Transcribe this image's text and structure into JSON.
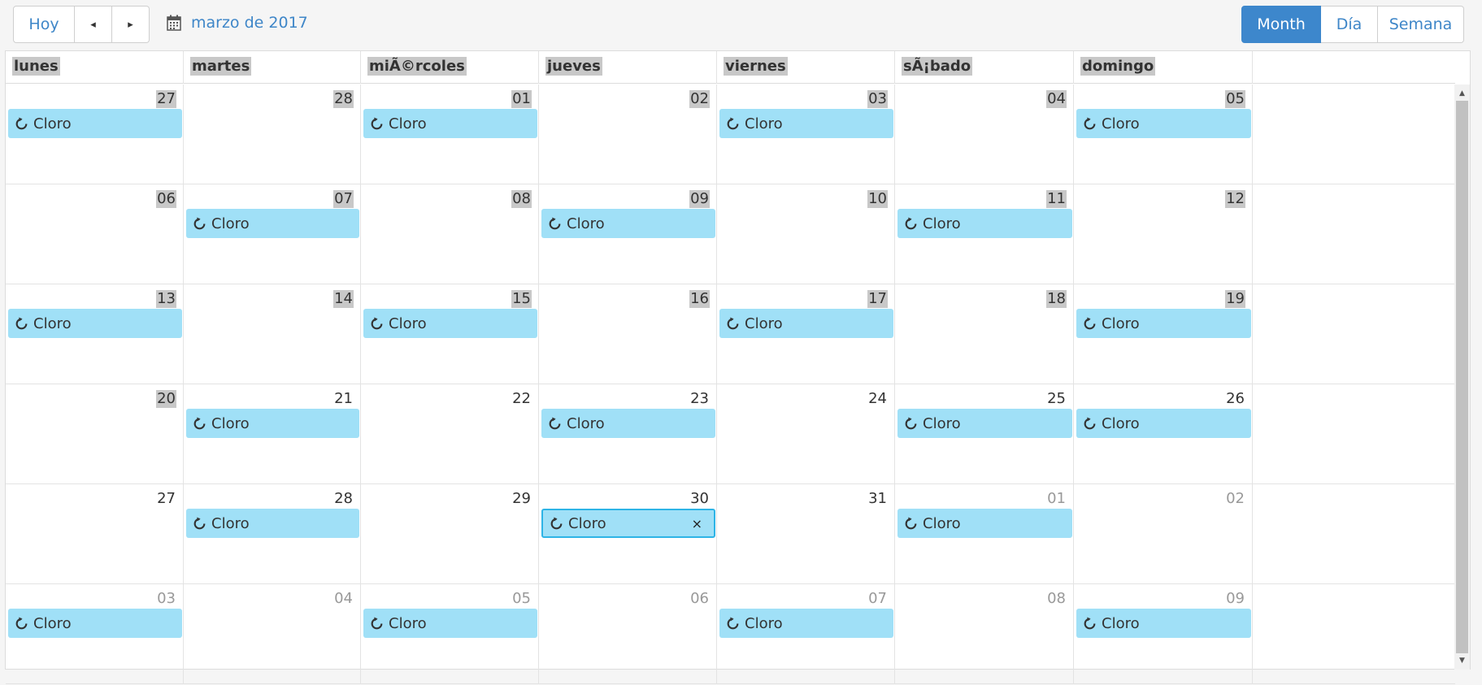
{
  "toolbar": {
    "today_label": "Hoy",
    "prev_label": "◂",
    "next_label": "▸",
    "date_label": "marzo de 2017",
    "calendar_icon": "calendar-icon",
    "views": [
      {
        "label": "Month",
        "active": true
      },
      {
        "label": "Día",
        "active": false
      },
      {
        "label": "Semana",
        "active": false
      }
    ]
  },
  "headers": [
    "lunes",
    "martes",
    "miÃ©rcoles",
    "jueves",
    "viernes",
    "sÃ¡bado",
    "domingo"
  ],
  "event_icon": "refresh-icon",
  "close_label": "×",
  "weeks": [
    [
      {
        "num": "27",
        "highlight": true,
        "other": false,
        "event": "Cloro"
      },
      {
        "num": "28",
        "highlight": true,
        "other": false,
        "event": ""
      },
      {
        "num": "01",
        "highlight": true,
        "other": false,
        "event": "Cloro"
      },
      {
        "num": "02",
        "highlight": true,
        "other": false,
        "event": ""
      },
      {
        "num": "03",
        "highlight": true,
        "other": false,
        "event": "Cloro"
      },
      {
        "num": "04",
        "highlight": true,
        "other": false,
        "event": ""
      },
      {
        "num": "05",
        "highlight": true,
        "other": false,
        "event": "Cloro"
      }
    ],
    [
      {
        "num": "06",
        "highlight": true,
        "other": false,
        "event": ""
      },
      {
        "num": "07",
        "highlight": true,
        "other": false,
        "event": "Cloro"
      },
      {
        "num": "08",
        "highlight": true,
        "other": false,
        "event": ""
      },
      {
        "num": "09",
        "highlight": true,
        "other": false,
        "event": "Cloro"
      },
      {
        "num": "10",
        "highlight": true,
        "other": false,
        "event": ""
      },
      {
        "num": "11",
        "highlight": true,
        "other": false,
        "event": "Cloro"
      },
      {
        "num": "12",
        "highlight": true,
        "other": false,
        "event": ""
      }
    ],
    [
      {
        "num": "13",
        "highlight": true,
        "other": false,
        "event": "Cloro"
      },
      {
        "num": "14",
        "highlight": true,
        "other": false,
        "event": ""
      },
      {
        "num": "15",
        "highlight": true,
        "other": false,
        "event": "Cloro"
      },
      {
        "num": "16",
        "highlight": true,
        "other": false,
        "event": ""
      },
      {
        "num": "17",
        "highlight": true,
        "other": false,
        "event": "Cloro"
      },
      {
        "num": "18",
        "highlight": true,
        "other": false,
        "event": ""
      },
      {
        "num": "19",
        "highlight": true,
        "other": false,
        "event": "Cloro"
      }
    ],
    [
      {
        "num": "20",
        "highlight": true,
        "other": false,
        "event": ""
      },
      {
        "num": "21",
        "highlight": false,
        "other": false,
        "event": "Cloro"
      },
      {
        "num": "22",
        "highlight": false,
        "other": false,
        "event": ""
      },
      {
        "num": "23",
        "highlight": false,
        "other": false,
        "event": "Cloro"
      },
      {
        "num": "24",
        "highlight": false,
        "other": false,
        "event": ""
      },
      {
        "num": "25",
        "highlight": false,
        "other": false,
        "event": "Cloro"
      },
      {
        "num": "26",
        "highlight": false,
        "other": false,
        "event": "Cloro"
      }
    ],
    [
      {
        "num": "27",
        "highlight": false,
        "other": false,
        "event": ""
      },
      {
        "num": "28",
        "highlight": false,
        "other": false,
        "event": "Cloro"
      },
      {
        "num": "29",
        "highlight": false,
        "other": false,
        "event": ""
      },
      {
        "num": "30",
        "highlight": false,
        "other": false,
        "event": "Cloro",
        "selected": true
      },
      {
        "num": "31",
        "highlight": false,
        "other": false,
        "event": ""
      },
      {
        "num": "01",
        "highlight": false,
        "other": true,
        "event": "Cloro"
      },
      {
        "num": "02",
        "highlight": false,
        "other": true,
        "event": ""
      }
    ],
    [
      {
        "num": "03",
        "highlight": false,
        "other": true,
        "event": "Cloro"
      },
      {
        "num": "04",
        "highlight": false,
        "other": true,
        "event": ""
      },
      {
        "num": "05",
        "highlight": false,
        "other": true,
        "event": "Cloro"
      },
      {
        "num": "06",
        "highlight": false,
        "other": true,
        "event": ""
      },
      {
        "num": "07",
        "highlight": false,
        "other": true,
        "event": "Cloro"
      },
      {
        "num": "08",
        "highlight": false,
        "other": true,
        "event": ""
      },
      {
        "num": "09",
        "highlight": false,
        "other": true,
        "event": "Cloro"
      }
    ]
  ],
  "scrollbar": {
    "up_label": "▲",
    "down_label": "▼"
  }
}
